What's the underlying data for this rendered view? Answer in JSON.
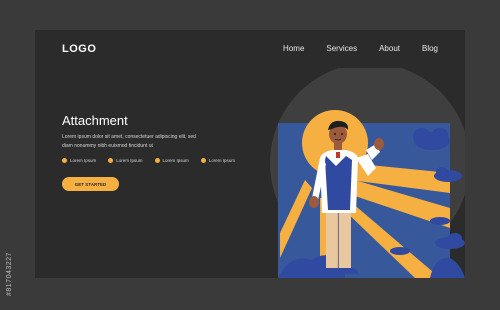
{
  "nav": {
    "logo": "LOGO",
    "links": [
      "Home",
      "Services",
      "About",
      "Blog"
    ]
  },
  "hero": {
    "title": "Attachment",
    "body": "Lorem ipsum dolor sit amet, consectetuer adipiscing elit, sed diam nonummy nibh euismod tincidunt ut",
    "bullets": [
      "Lorem Ipsum",
      "Lorem Ipsum",
      "Lorem Ipsum",
      "Lorem Ipsum"
    ],
    "cta": "GET STARTED"
  },
  "watermark": {
    "side_id": "#817043227"
  },
  "colors": {
    "accent": "#f5b041",
    "background": "#2b2b2b",
    "frame": "#3a3a3a",
    "blue": "#2f4aa0"
  }
}
